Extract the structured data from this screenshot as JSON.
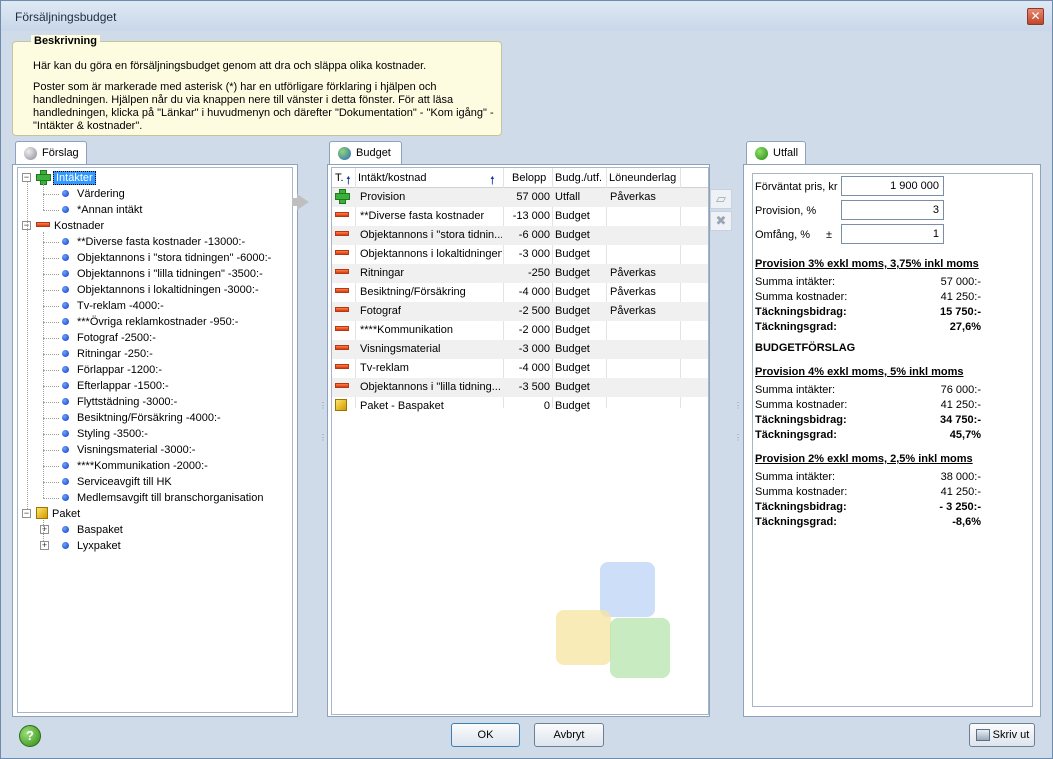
{
  "window": {
    "title": "Försäljningsbudget",
    "close": "✕"
  },
  "description": {
    "title": "Beskrivning",
    "p1": "Här kan du göra en försäljningsbudget genom att dra och släppa olika kostnader.",
    "p2": "Poster som är markerade med asterisk (*) har en utförligare förklaring i hjälpen och handledningen. Hjälpen når du via knappen nere till vänster i detta fönster. För att läsa handledningen, klicka på \"Länkar\" i huvudmenyn och därefter \"Dokumentation\" - \"Kom igång\" - \"Intäkter & kostnader\"."
  },
  "tabs": {
    "forslag": "Förslag",
    "budget": "Budget",
    "utfall": "Utfall"
  },
  "tree": {
    "intakter": "Intäkter",
    "intakter_items": [
      "Värdering",
      "*Annan intäkt"
    ],
    "kostnader": "Kostnader",
    "kostnader_items": [
      "**Diverse fasta kostnader -13000:-",
      "Objektannons i \"stora tidningen\" -6000:-",
      "Objektannons i \"lilla tidningen\" -3500:-",
      "Objektannons i lokaltidningen -3000:-",
      "Tv-reklam -4000:-",
      "***Övriga reklamkostnader -950:-",
      "Fotograf -2500:-",
      "Ritningar -250:-",
      "Förlappar -1200:-",
      "Efterlappar -1500:-",
      "Flyttstädning -3000:-",
      "Besiktning/Försäkring -4000:-",
      "Styling -3500:-",
      "Visningsmaterial -3000:-",
      "****Kommunikation -2000:-",
      "Serviceavgift till HK",
      "Medlemsavgift till branschorganisation"
    ],
    "paket": "Paket",
    "paket_items": [
      "Baspaket",
      "Lyxpaket"
    ]
  },
  "budget_table": {
    "headers": {
      "t": "T.",
      "name": "Intäkt/kostnad",
      "belopp": "Belopp",
      "budg": "Budg./utf.",
      "lone": "Löneunderlag"
    },
    "rows": [
      {
        "icon": "plus",
        "name": "Provision",
        "belopp": "57 000",
        "budg": "Utfall",
        "lone": "Påverkas"
      },
      {
        "icon": "minus",
        "name": "**Diverse fasta kostnader",
        "belopp": "-13 000",
        "budg": "Budget",
        "lone": ""
      },
      {
        "icon": "minus",
        "name": "Objektannons i \"stora tidnin...",
        "belopp": "-6 000",
        "budg": "Budget",
        "lone": ""
      },
      {
        "icon": "minus",
        "name": "Objektannons i lokaltidningen",
        "belopp": "-3 000",
        "budg": "Budget",
        "lone": ""
      },
      {
        "icon": "minus",
        "name": "Ritningar",
        "belopp": "-250",
        "budg": "Budget",
        "lone": "Påverkas"
      },
      {
        "icon": "minus",
        "name": "Besiktning/Försäkring",
        "belopp": "-4 000",
        "budg": "Budget",
        "lone": "Påverkas"
      },
      {
        "icon": "minus",
        "name": "Fotograf",
        "belopp": "-2 500",
        "budg": "Budget",
        "lone": "Påverkas"
      },
      {
        "icon": "minus",
        "name": "****Kommunikation",
        "belopp": "-2 000",
        "budg": "Budget",
        "lone": ""
      },
      {
        "icon": "minus",
        "name": "Visningsmaterial",
        "belopp": "-3 000",
        "budg": "Budget",
        "lone": ""
      },
      {
        "icon": "minus",
        "name": "Tv-reklam",
        "belopp": "-4 000",
        "budg": "Budget",
        "lone": ""
      },
      {
        "icon": "minus",
        "name": "Objektannons i \"lilla tidning...",
        "belopp": "-3 500",
        "budg": "Budget",
        "lone": ""
      },
      {
        "icon": "cube",
        "name": "Paket - Baspaket",
        "belopp": "0",
        "budg": "Budget",
        "lone": ""
      }
    ]
  },
  "utfall": {
    "pris_label": "Förväntat pris, kr",
    "pris_value": "1 900 000",
    "provision_label": "Provision, %",
    "provision_value": "3",
    "omfang_label": "Omfång, %",
    "omfang_pm": "±",
    "omfang_value": "1",
    "s1": {
      "title": "Provision 3% exkl moms, 3,75% inkl moms",
      "intakter_label": "Summa intäkter:",
      "intakter": "57 000:-",
      "kostnader_label": "Summa kostnader:",
      "kostnader": "41 250:-",
      "bidrag_label": "Täckningsbidrag:",
      "bidrag": "15 750:-",
      "grad_label": "Täckningsgrad:",
      "grad": "27,6%"
    },
    "budgetforslag": "BUDGETFÖRSLAG",
    "s2": {
      "title": "Provision 4% exkl moms, 5% inkl moms",
      "intakter_label": "Summa intäkter:",
      "intakter": "76 000:-",
      "kostnader_label": "Summa kostnader:",
      "kostnader": "41 250:-",
      "bidrag_label": "Täckningsbidrag:",
      "bidrag": "34 750:-",
      "grad_label": "Täckningsgrad:",
      "grad": "45,7%"
    },
    "s3": {
      "title": "Provision 2% exkl moms, 2,5% inkl moms",
      "intakter_label": "Summa intäkter:",
      "intakter": "38 000:-",
      "kostnader_label": "Summa kostnader:",
      "kostnader": "41 250:-",
      "bidrag_label": "Täckningsbidrag:",
      "bidrag": "-  3 250:-",
      "grad_label": "Täckningsgrad:",
      "grad": "-8,6%"
    }
  },
  "buttons": {
    "help": "?",
    "ok": "OK",
    "avbryt": "Avbryt",
    "skriv_ut": "Skriv ut"
  }
}
